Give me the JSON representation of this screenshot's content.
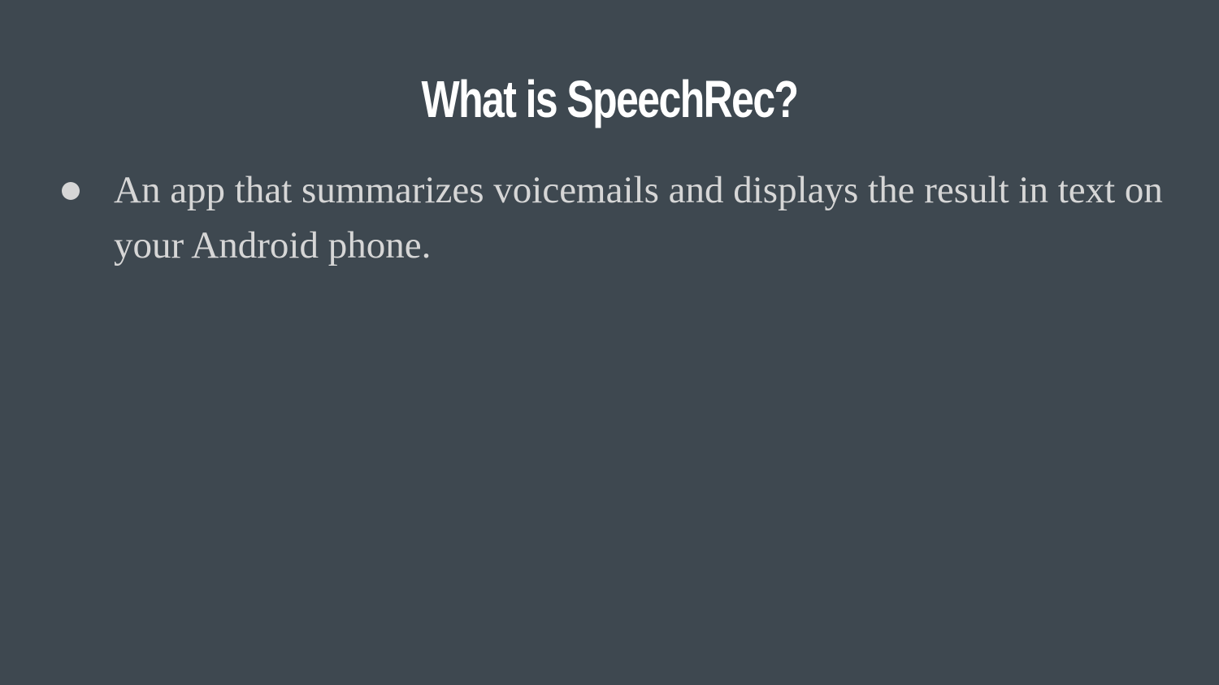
{
  "slide": {
    "title": "What is SpeechRec?",
    "bullets": [
      "An app that summarizes voicemails and displays the result in text on your Android phone."
    ]
  }
}
